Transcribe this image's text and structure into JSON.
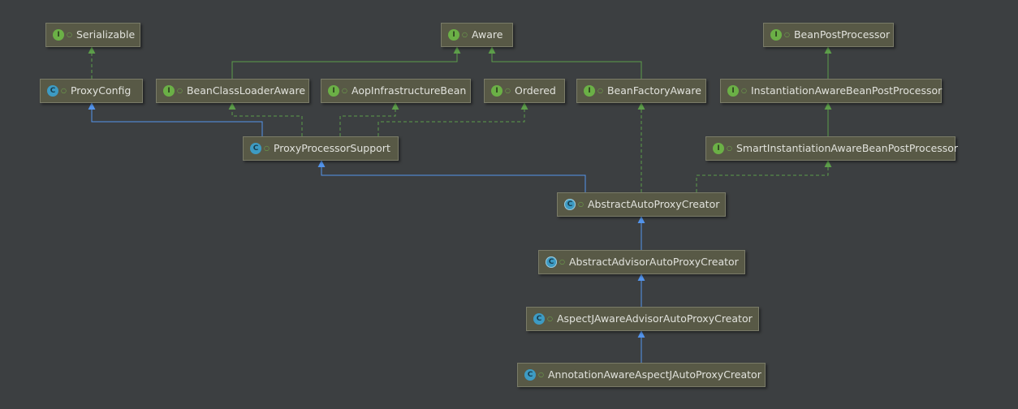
{
  "diagram": {
    "nodes": [
      {
        "id": "serializable",
        "label": "Serializable",
        "kind": "interface",
        "badge": "I"
      },
      {
        "id": "aware",
        "label": "Aware",
        "kind": "interface",
        "badge": "I"
      },
      {
        "id": "bean-post-processor",
        "label": "BeanPostProcessor",
        "kind": "interface",
        "badge": "I"
      },
      {
        "id": "proxy-config",
        "label": "ProxyConfig",
        "kind": "class",
        "badge": "C"
      },
      {
        "id": "bean-class-loader-aware",
        "label": "BeanClassLoaderAware",
        "kind": "interface",
        "badge": "I"
      },
      {
        "id": "aop-infrastructure-bean",
        "label": "AopInfrastructureBean",
        "kind": "interface",
        "badge": "I"
      },
      {
        "id": "ordered",
        "label": "Ordered",
        "kind": "interface",
        "badge": "I"
      },
      {
        "id": "bean-factory-aware",
        "label": "BeanFactoryAware",
        "kind": "interface",
        "badge": "I"
      },
      {
        "id": "instantiation-aware-bean-post-processor",
        "label": "InstantiationAwareBeanPostProcessor",
        "kind": "interface",
        "badge": "I"
      },
      {
        "id": "proxy-processor-support",
        "label": "ProxyProcessorSupport",
        "kind": "class",
        "badge": "C"
      },
      {
        "id": "smart-instantiation-aware-bean-post-processor",
        "label": "SmartInstantiationAwareBeanPostProcessor",
        "kind": "interface",
        "badge": "I"
      },
      {
        "id": "abstract-auto-proxy-creator",
        "label": "AbstractAutoProxyCreator",
        "kind": "abstract",
        "badge": "C"
      },
      {
        "id": "abstract-advisor-auto-proxy-creator",
        "label": "AbstractAdvisorAutoProxyCreator",
        "kind": "abstract",
        "badge": "C"
      },
      {
        "id": "aspectj-aware-advisor-auto-proxy-creator",
        "label": "AspectJAwareAdvisorAutoProxyCreator",
        "kind": "class",
        "badge": "C"
      },
      {
        "id": "annotation-aware-aspectj-auto-proxy-creator",
        "label": "AnnotationAwareAspectJAutoProxyCreator",
        "kind": "class",
        "badge": "C"
      }
    ],
    "edges": [
      {
        "from": "proxy-config",
        "to": "serializable",
        "type": "implements"
      },
      {
        "from": "bean-class-loader-aware",
        "to": "aware",
        "type": "extends-interface"
      },
      {
        "from": "bean-factory-aware",
        "to": "aware",
        "type": "extends-interface"
      },
      {
        "from": "instantiation-aware-bean-post-processor",
        "to": "bean-post-processor",
        "type": "extends-interface"
      },
      {
        "from": "smart-instantiation-aware-bean-post-processor",
        "to": "instantiation-aware-bean-post-processor",
        "type": "extends-interface"
      },
      {
        "from": "proxy-processor-support",
        "to": "proxy-config",
        "type": "extends"
      },
      {
        "from": "proxy-processor-support",
        "to": "bean-class-loader-aware",
        "type": "implements"
      },
      {
        "from": "proxy-processor-support",
        "to": "aop-infrastructure-bean",
        "type": "implements"
      },
      {
        "from": "proxy-processor-support",
        "to": "ordered",
        "type": "implements"
      },
      {
        "from": "abstract-auto-proxy-creator",
        "to": "proxy-processor-support",
        "type": "extends"
      },
      {
        "from": "abstract-auto-proxy-creator",
        "to": "bean-factory-aware",
        "type": "implements"
      },
      {
        "from": "abstract-auto-proxy-creator",
        "to": "smart-instantiation-aware-bean-post-processor",
        "type": "implements"
      },
      {
        "from": "abstract-advisor-auto-proxy-creator",
        "to": "abstract-auto-proxy-creator",
        "type": "extends"
      },
      {
        "from": "aspectj-aware-advisor-auto-proxy-creator",
        "to": "abstract-advisor-auto-proxy-creator",
        "type": "extends"
      },
      {
        "from": "annotation-aware-aspectj-auto-proxy-creator",
        "to": "aspectj-aware-advisor-auto-proxy-creator",
        "type": "extends"
      }
    ],
    "colors": {
      "background": "#3c3f41",
      "node_fill": "#585946",
      "node_border": "#7a7b68",
      "node_text": "#e1e2dc",
      "interface_badge": "#6bb046",
      "class_badge": "#3d9bc3",
      "extends_edge": "#5394ec",
      "implements_edge": "#5d9e4a"
    }
  }
}
